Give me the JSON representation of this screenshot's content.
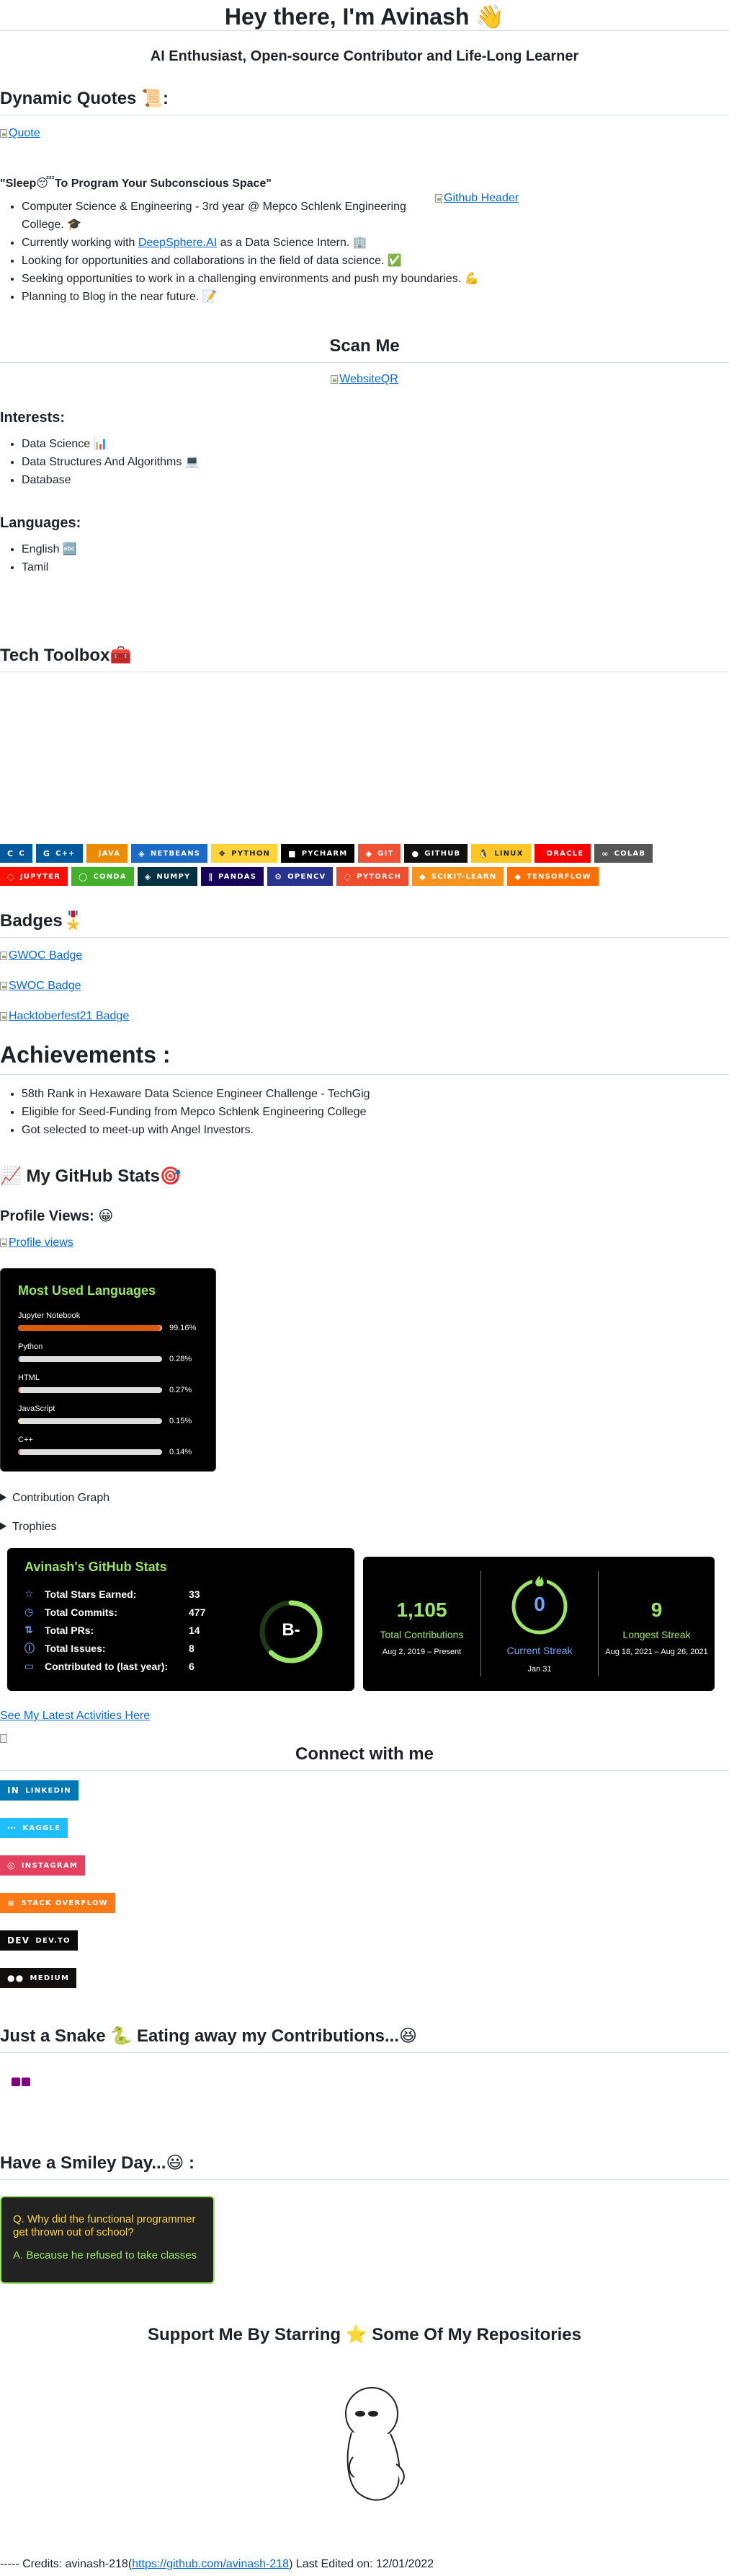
{
  "header": {
    "title": "Hey there, I'm Avinash 👋",
    "subtitle": "AI Enthusiast, Open-source Contributor and Life-Long Learner"
  },
  "quotes": {
    "heading": "Dynamic Quotes 📜:",
    "image_alt": "Quote"
  },
  "about": {
    "tagline": "\"Sleep😴To Program Your Subconscious Space\"",
    "github_header_alt": "Github Header",
    "items": [
      {
        "text": "Computer Science & Engineering - 3rd year @ Mepco Schlenk Engineering College. 🎓"
      },
      {
        "prefix": "Currently working with ",
        "link": "DeepSphere.AI",
        "suffix": " as a Data Science Intern. 🏢"
      },
      {
        "text": "Looking for opportunities and collaborations in the field of data science. ✅"
      },
      {
        "text": "Seeking opportunities to work in a challenging environments and push my boundaries. 💪"
      },
      {
        "text": "Planning to Blog in the near future. 📝"
      }
    ]
  },
  "scan": {
    "heading": "Scan Me",
    "qr_alt": "WebsiteQR"
  },
  "interests": {
    "heading": "Interests:",
    "items": [
      "Data Science 📊",
      "Data Structures And Algorithms 💻",
      "Database"
    ]
  },
  "languages": {
    "heading": "Languages:",
    "items": [
      "English 🔤",
      "Tamil"
    ]
  },
  "toolbox": {
    "heading": "Tech Toolbox🧰",
    "row1": [
      {
        "label": "C",
        "icon": "C",
        "color": "#00599C"
      },
      {
        "label": "C++",
        "icon": "G",
        "color": "#00599C"
      },
      {
        "label": "Java",
        "icon": "",
        "color": "#ED8B00"
      },
      {
        "label": "NetBeans",
        "icon": "◈",
        "color": "#1B6AC6"
      },
      {
        "label": "Python",
        "icon": "❖",
        "color": "#FFD43B",
        "text": "#1f2328"
      },
      {
        "label": "PyCharm",
        "icon": "■",
        "color": "#000000"
      },
      {
        "label": "Git",
        "icon": "◆",
        "color": "#F05033"
      },
      {
        "label": "GitHub",
        "icon": "●",
        "color": "#121011"
      },
      {
        "label": "Linux",
        "icon": "🐧",
        "color": "#FCC624",
        "text": "#1f2328"
      },
      {
        "label": "Oracle",
        "icon": "",
        "color": "#F80000"
      },
      {
        "label": "Colab",
        "icon": "∞",
        "color": "#555555"
      }
    ],
    "row2": [
      {
        "label": "Jupyter",
        "icon": "◌",
        "color": "#FA0F00"
      },
      {
        "label": "Conda",
        "icon": "◯",
        "color": "#342B029"
      },
      {
        "label": "Numpy",
        "icon": "◈",
        "color": "#013243"
      },
      {
        "label": "Pandas",
        "icon": "∥",
        "color": "#150458"
      },
      {
        "label": "OpenCV",
        "icon": "⚙",
        "color": "#27338e"
      },
      {
        "label": "PyTorch",
        "icon": "◌",
        "color": "#EE4C2C"
      },
      {
        "label": "scikit-learn",
        "icon": "◆",
        "color": "#F7931E"
      },
      {
        "label": "TensorFlow",
        "icon": "◆",
        "color": "#FF6F00"
      }
    ]
  },
  "badges": {
    "heading": "Badges🎖️",
    "items": [
      "GWOC Badge",
      "SWOC Badge",
      "Hacktoberfest21 Badge"
    ]
  },
  "achievements": {
    "heading": "Achievements :",
    "items": [
      "58th Rank in Hexaware Data Science Engineer Challenge - TechGig",
      "Eligible for Seed-Funding from Mepco Schlenk Engineering College",
      "Got selected to meet-up with Angel Investors."
    ]
  },
  "stats_section": {
    "heading": "📈 My GitHub Stats🎯",
    "profile_views_heading": "Profile Views: 😀",
    "profile_views_alt": "Profile views"
  },
  "top_langs": {
    "title": "Most Used Languages",
    "items": [
      {
        "name": "Jupyter Notebook",
        "pct_label": "99.16%",
        "pct": 99.16,
        "color": "#DA5B0B"
      },
      {
        "name": "Python",
        "pct_label": "0.28%",
        "pct": 0.28,
        "color": "#3572A5"
      },
      {
        "name": "HTML",
        "pct_label": "0.27%",
        "pct": 0.27,
        "color": "#e34c26"
      },
      {
        "name": "JavaScript",
        "pct_label": "0.15%",
        "pct": 0.15,
        "color": "#f1e05a"
      },
      {
        "name": "C++",
        "pct_label": "0.14%",
        "pct": 0.14,
        "color": "#f34b7d"
      }
    ]
  },
  "details": {
    "contribution_graph": "Contribution Graph",
    "trophies": "Trophies"
  },
  "gh_stats": {
    "title": "Avinash's GitHub Stats",
    "rank": "B-",
    "rows": [
      {
        "icon": "☆",
        "label": "Total Stars Earned:",
        "value": "33"
      },
      {
        "icon": "◷",
        "label": "Total Commits:",
        "value": "477"
      },
      {
        "icon": "⇅",
        "label": "Total PRs:",
        "value": "14"
      },
      {
        "icon": "ⓘ",
        "label": "Total Issues:",
        "value": "8"
      },
      {
        "icon": "▭",
        "label": "Contributed to (last year):",
        "value": "6"
      }
    ]
  },
  "streak": {
    "total_value": "1,105",
    "total_label": "Total Contributions",
    "total_range": "Aug 2, 2019 – Present",
    "current_value": "0",
    "current_label": "Current Streak",
    "current_date": "Jan 31",
    "longest_value": "9",
    "longest_label": "Longest Streak",
    "longest_range": "Aug 18, 2021 – Aug 26, 2021"
  },
  "activities": {
    "link": "See My Latest Activities Here"
  },
  "connect": {
    "heading": "Connect with me",
    "items": [
      {
        "label": "LinkedIn",
        "icon": "in",
        "color": "#0077B5"
      },
      {
        "label": "Kaggle",
        "icon": "⋯",
        "color": "#20BEFF"
      },
      {
        "label": "Instagram",
        "icon": "◎",
        "color": "#E4405F"
      },
      {
        "label": "Stack Overflow",
        "icon": "≡",
        "color": "#FE7A16"
      },
      {
        "label": "Dev.to",
        "icon": "DEV",
        "color": "#0A0A0A"
      },
      {
        "label": "Medium",
        "icon": "●●",
        "color": "#12100E"
      }
    ]
  },
  "snake": {
    "heading": "Just a Snake 🐍 Eating away my Contributions...😆"
  },
  "joke": {
    "heading": "Have a Smiley Day...😃 :",
    "question": "Q. Why did the functional programmer get thrown out of school?",
    "answer": "A. Because he refused to take classes"
  },
  "support": {
    "heading": "Support Me By Starring ⭐ Some Of My Repositories"
  },
  "footer": {
    "prefix": "----- Credits: avinash-218(",
    "link": "https://github.com/avinash-218",
    "suffix": ") Last Edited on: 12/01/2022"
  },
  "colors": {
    "accent_green": "#9be564",
    "stats_blue": "#70a5fd",
    "link": "#0969da"
  }
}
